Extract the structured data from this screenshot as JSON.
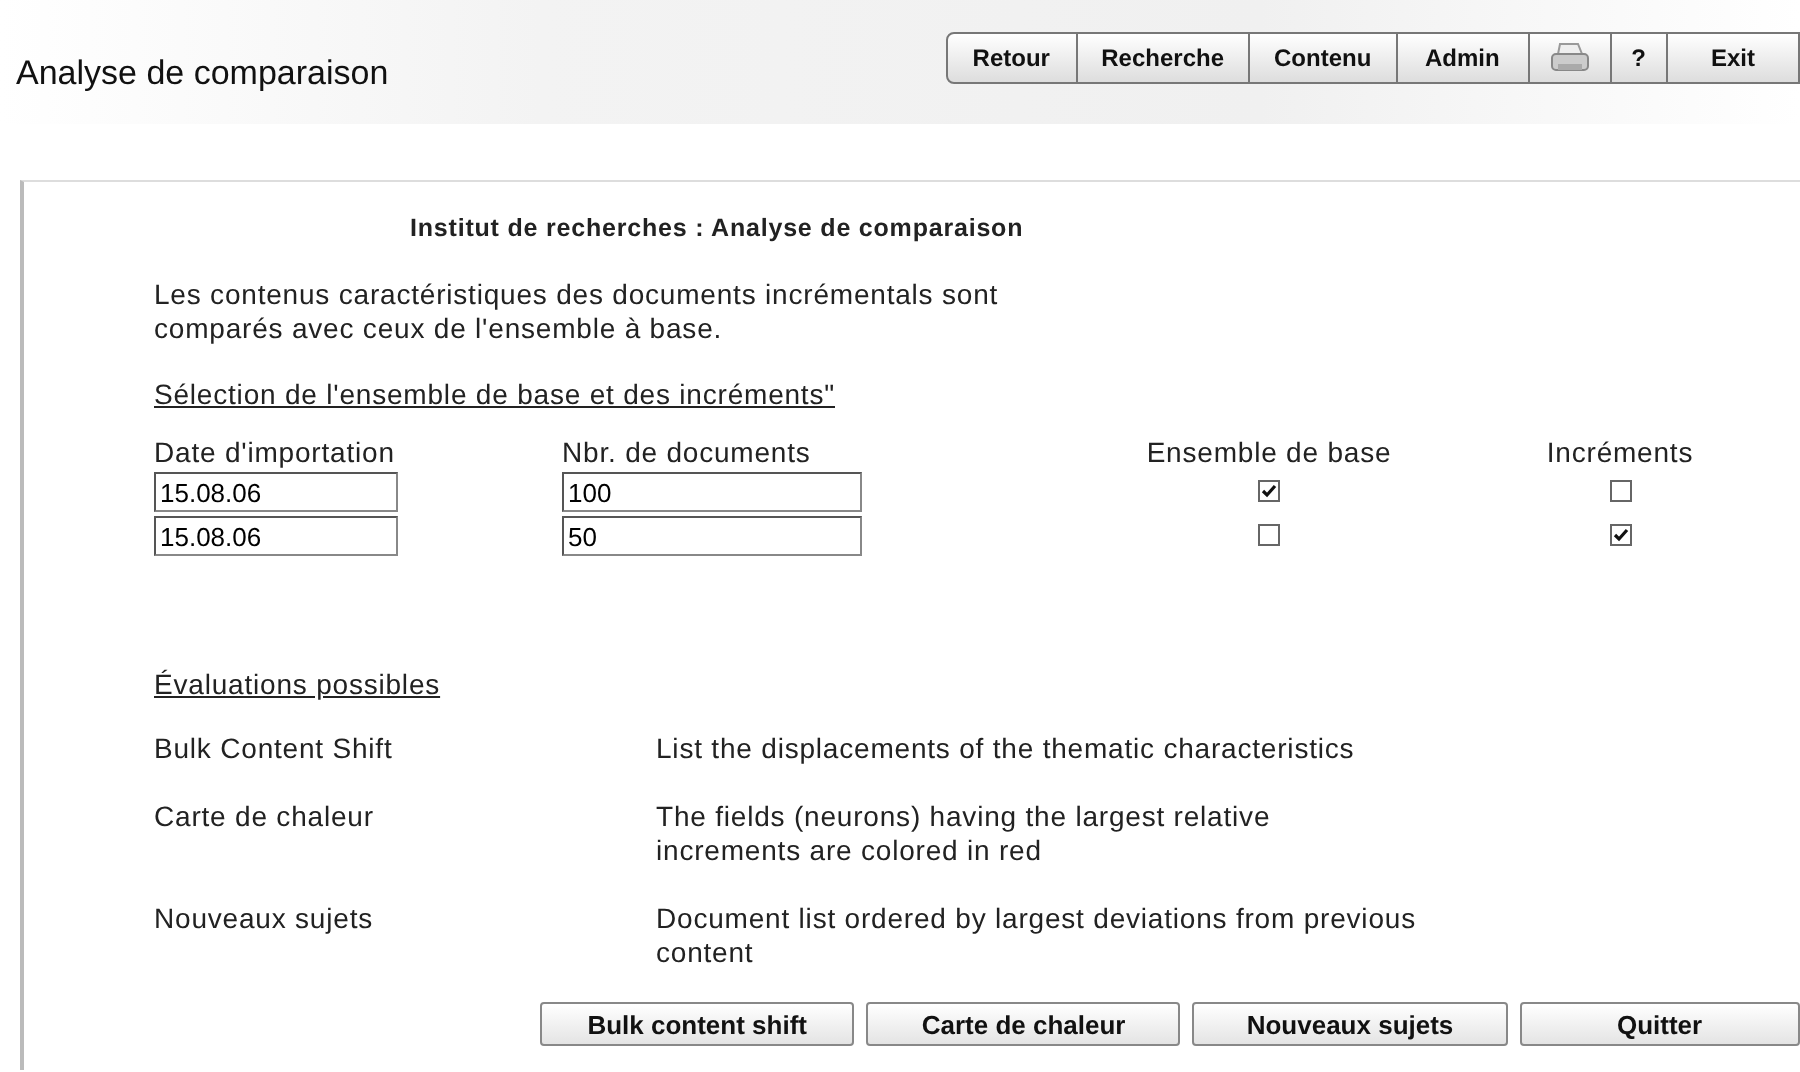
{
  "header": {
    "title": "Analyse de comparaison",
    "toolbar": [
      {
        "kind": "text",
        "label": "Retour"
      },
      {
        "kind": "text",
        "label": "Recherche"
      },
      {
        "kind": "text",
        "label": "Contenu"
      },
      {
        "kind": "text",
        "label": "Admin"
      },
      {
        "kind": "printer"
      },
      {
        "kind": "text",
        "label": "?"
      },
      {
        "kind": "text",
        "label": "Exit"
      }
    ]
  },
  "panel": {
    "title": "Institut de recherches : Analyse de comparaison",
    "intro": "Les contenus caractéristiques des documents incrémentals sont comparés avec ceux de l'ensemble à base.",
    "selection_link": "Sélection de l'ensemble de base et des incréments\"",
    "columns": [
      "Date d'importation",
      "Nbr. de documents",
      "Ensemble de base",
      "Incréments"
    ],
    "rows": [
      {
        "date": "15.08.06",
        "documents": "100",
        "base_set": true,
        "increment": false
      },
      {
        "date": "15.08.06",
        "documents": "50",
        "base_set": false,
        "increment": true
      }
    ],
    "evaluations_link": "Évaluations possibles",
    "evaluations": [
      {
        "name": "Bulk Content Shift",
        "description": "List the displacements of the thematic characteristics"
      },
      {
        "name": "Carte de chaleur",
        "description": "The fields (neurons) having the largest relative increments are colored in red"
      },
      {
        "name": "Nouveaux sujets",
        "description": "Document list ordered by largest deviations from previous content"
      }
    ],
    "buttons": [
      "Bulk content shift",
      "Carte de chaleur",
      "Nouveaux sujets",
      "Quitter"
    ]
  }
}
